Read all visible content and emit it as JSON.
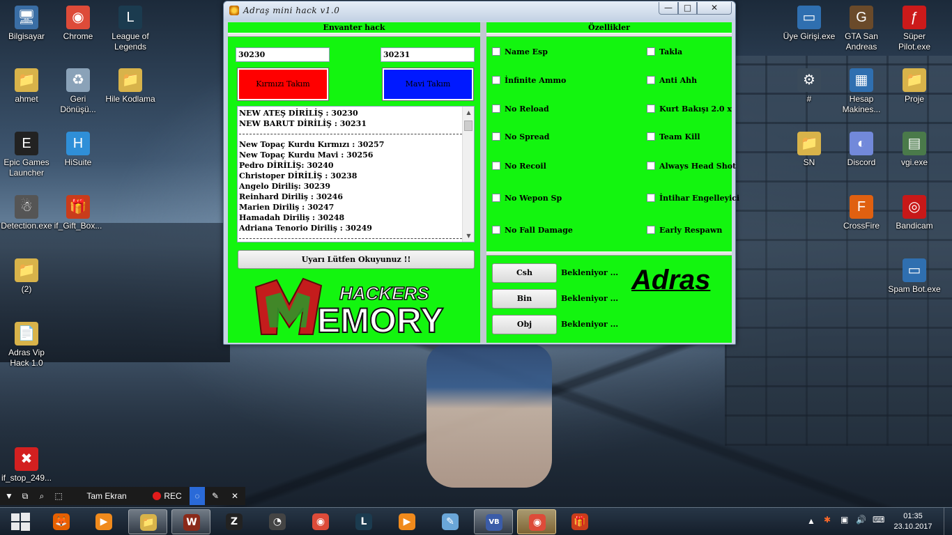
{
  "desktop": {
    "icons_left": [
      {
        "label": "Bilgisayar",
        "glyph": "🖥",
        "color": "#3a6ea5"
      },
      {
        "label": "Chrome",
        "glyph": "◉",
        "color": "#dd4b39"
      },
      {
        "label": "League of Legends",
        "glyph": "L",
        "color": "#1b3b4f"
      },
      {
        "label": "ahmet",
        "glyph": "📁",
        "color": "#d8b34a"
      },
      {
        "label": "Geri Dönüşü...",
        "glyph": "♻",
        "color": "#8aa2b8"
      },
      {
        "label": "Hile Kodlama",
        "glyph": "📁",
        "color": "#d8b34a"
      },
      {
        "label": "Epic Games Launcher",
        "glyph": "E",
        "color": "#222222"
      },
      {
        "label": "HiSuite",
        "glyph": "H",
        "color": "#2f8fd8"
      },
      {
        "label": "Detection.exe",
        "glyph": "☃",
        "color": "#555555"
      },
      {
        "label": "if_Gift_Box...",
        "glyph": "🎁",
        "color": "#c93c1b"
      },
      {
        "label": "(2)",
        "glyph": "📁",
        "color": "#d8b34a"
      },
      {
        "label": "Adras Vip Hack 1.0",
        "glyph": "📄",
        "color": "#d8b34a"
      },
      {
        "label": "if_stop_249...",
        "glyph": "✖",
        "color": "#d32020"
      }
    ],
    "icons_right": [
      {
        "label": "Üye Girişi.exe",
        "glyph": "▭",
        "color": "#2f6fb0"
      },
      {
        "label": "GTA San Andreas",
        "glyph": "G",
        "color": "#6a4a2a"
      },
      {
        "label": "Süper Pilot.exe",
        "glyph": "ƒ",
        "color": "#cc1a1a"
      },
      {
        "label": "#",
        "glyph": "⚙",
        "color": "#3a4a5a"
      },
      {
        "label": "Hesap Makines...",
        "glyph": "▦",
        "color": "#2f6fb0"
      },
      {
        "label": "Proje",
        "glyph": "📁",
        "color": "#d8b34a"
      },
      {
        "label": "SN",
        "glyph": "📁",
        "color": "#d8b34a"
      },
      {
        "label": "Discord",
        "glyph": "◐",
        "color": "#7289da"
      },
      {
        "label": "vgi.exe",
        "glyph": "▤",
        "color": "#4a7a4a"
      },
      {
        "label": "CrossFire",
        "glyph": "F",
        "color": "#e06010"
      },
      {
        "label": "Bandicam",
        "glyph": "◎",
        "color": "#c81818"
      },
      {
        "label": "Spam Bot.exe",
        "glyph": "▭",
        "color": "#2f6fb0"
      }
    ]
  },
  "window": {
    "title": "Adraş mini hack v1.0",
    "minimize": "—",
    "maximize": "□",
    "close": "✕"
  },
  "inventory": {
    "heading": "Envanter hack",
    "input_left": "30230",
    "input_right": "30231",
    "red_button": "Kırmızı Takım",
    "blue_button": "Mavi Takım",
    "red_color": "#ff0000",
    "blue_color": "#0019ff",
    "list_top": [
      "NEW ATEŞ DİRİLİŞ : 30230",
      "NEW BARUT DİRİLİŞ : 30231"
    ],
    "list_items": [
      "New Topaç Kurdu Kırmızı : 30257",
      "New Topaç Kurdu Mavi : 30256",
      "Pedro DİRİLİŞ: 30240",
      "Christoper DİRİLİŞ : 30238",
      "Angelo Diriliş: 30239",
      "Reinhard Diriliş : 30246",
      "Marien Diriliş : 30247",
      "Hamadah Diriliş : 30248",
      "Adriana Tenorio Diriliş : 30249"
    ],
    "warning_button": "Uyarı Lütfen Okuyunuz !!",
    "logo_top": "HACKERS",
    "logo_bottom": "EMORY"
  },
  "features": {
    "heading": "Özellikler",
    "left": [
      "Name Esp",
      "İnfinite Ammo",
      "No Reload",
      "No Spread",
      "No Recoil",
      "No Wepon Sp",
      "No Fall Damage"
    ],
    "right": [
      "Takla",
      "Anti Ahh",
      "Kurt Bakışı 2.0 x",
      "Team Kill",
      "Always Head Shot",
      "İntihar Engelleyici",
      "Early Respawn"
    ],
    "actions": [
      {
        "label": "Csh",
        "status": "Bekleniyor ..."
      },
      {
        "label": "Bin",
        "status": "Bekleniyor ..."
      },
      {
        "label": "Obj",
        "status": "Bekleniyor ..."
      }
    ],
    "brand": "Adras",
    "panel_color": "#13f50f"
  },
  "recorder": {
    "fullscreen": "Tam Ekran",
    "rec": "REC"
  },
  "taskbar": {
    "apps": [
      {
        "name": "firefox",
        "glyph": "🦊",
        "color": "#e66000"
      },
      {
        "name": "media-player",
        "glyph": "▶",
        "color": "#f08a1c"
      },
      {
        "name": "file-explorer",
        "glyph": "📁",
        "color": "#d8b34a"
      },
      {
        "name": "game-w",
        "glyph": "W",
        "color": "#8a2a1a"
      },
      {
        "name": "game-z",
        "glyph": "Z",
        "color": "#222222"
      },
      {
        "name": "obs",
        "glyph": "◔",
        "color": "#444444"
      },
      {
        "name": "chrome",
        "glyph": "◉",
        "color": "#dd4b39"
      },
      {
        "name": "league-of-legends",
        "glyph": "L",
        "color": "#1b3b4f"
      },
      {
        "name": "media-player-2",
        "glyph": "▶",
        "color": "#f08a1c"
      },
      {
        "name": "notepad",
        "glyph": "✎",
        "color": "#6aa6d8"
      },
      {
        "name": "visual-basic",
        "glyph": "VB",
        "color": "#3b5ca8"
      },
      {
        "name": "chrome-2",
        "glyph": "◉",
        "color": "#dd4b39"
      },
      {
        "name": "gift-box",
        "glyph": "🎁",
        "color": "#c93c1b"
      }
    ],
    "time": "01:35",
    "date": "23.10.2017"
  }
}
